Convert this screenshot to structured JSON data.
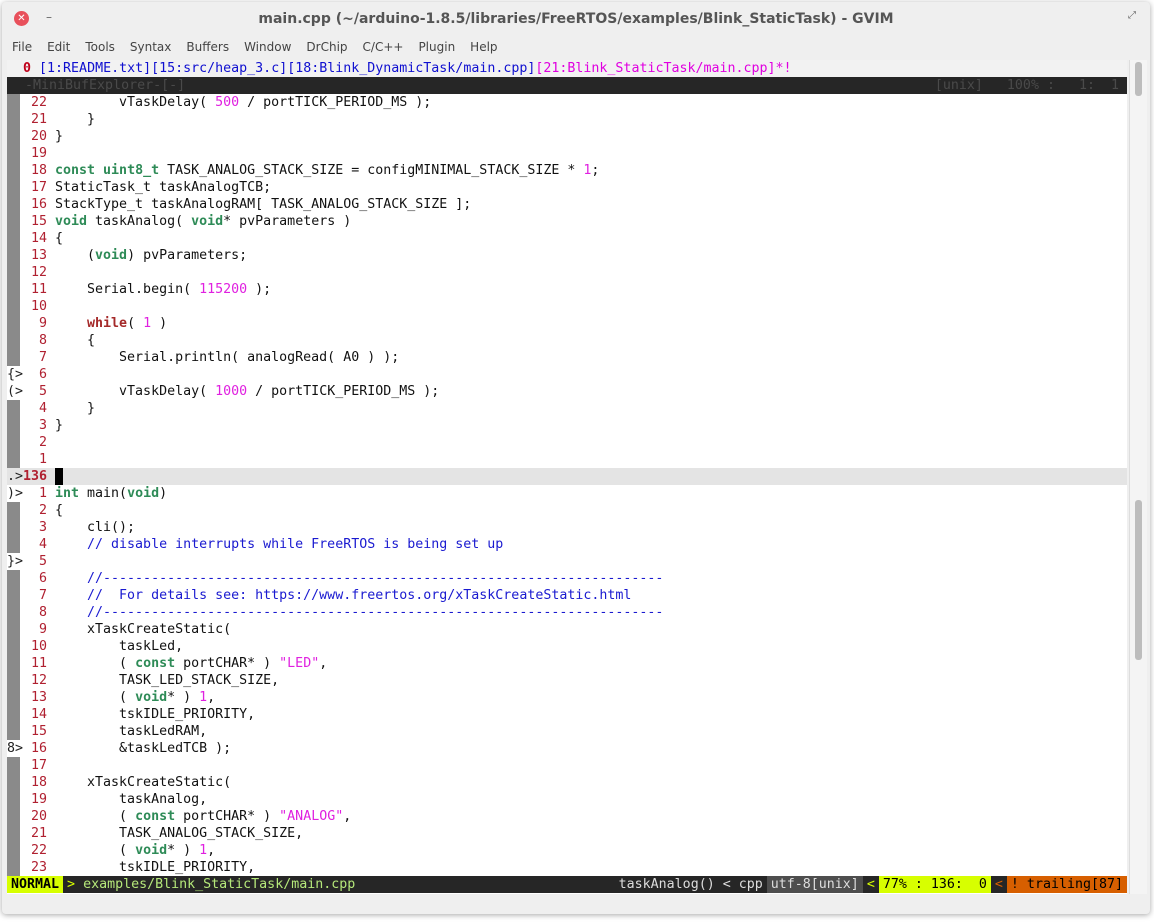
{
  "window": {
    "title": "main.cpp (~/arduino-1.8.5/libraries/FreeRTOS/examples/Blink_StaticTask) - GVIM"
  },
  "menu": [
    "File",
    "Edit",
    "Tools",
    "Syntax",
    "Buffers",
    "Window",
    "DrChip",
    "C/C++",
    "Plugin",
    "Help"
  ],
  "tabline": {
    "num": "0",
    "buffers": "[1:README.txt][15:src/heap_3.c][18:Blink_DynamicTask/main.cpp]",
    "active": "[21:Blink_StaticTask/main.cpp]*!"
  },
  "minibuf": {
    "left": "-MiniBufExplorer-[-]",
    "right": "[unix]   100% :   1:  1"
  },
  "lines": [
    {
      "n": "22",
      "t": [
        [
          "",
          "        vTaskDelay( "
        ],
        [
          "num",
          "500"
        ],
        [
          "",
          " / portTICK_PERIOD_MS );"
        ]
      ]
    },
    {
      "n": "21",
      "t": [
        [
          "",
          "    }"
        ]
      ]
    },
    {
      "n": "20",
      "t": [
        [
          "",
          "}"
        ]
      ]
    },
    {
      "n": "19",
      "t": []
    },
    {
      "n": "18",
      "t": [
        [
          "type",
          "const"
        ],
        [
          "",
          " "
        ],
        [
          "type",
          "uint8_t"
        ],
        [
          "",
          " TASK_ANALOG_STACK_SIZE = configMINIMAL_STACK_SIZE * "
        ],
        [
          "num",
          "1"
        ],
        [
          "",
          ";"
        ]
      ]
    },
    {
      "n": "17",
      "t": [
        [
          "",
          "StaticTask_t taskAnalogTCB;"
        ]
      ]
    },
    {
      "n": "16",
      "t": [
        [
          "",
          "StackType_t taskAnalogRAM[ TASK_ANALOG_STACK_SIZE ];"
        ]
      ]
    },
    {
      "n": "15",
      "t": [
        [
          "type",
          "void"
        ],
        [
          "",
          " taskAnalog( "
        ],
        [
          "type",
          "void"
        ],
        [
          "",
          "* pvParameters )"
        ]
      ]
    },
    {
      "n": "14",
      "t": [
        [
          "",
          "{"
        ]
      ]
    },
    {
      "n": "13",
      "t": [
        [
          "",
          "    ("
        ],
        [
          "type",
          "void"
        ],
        [
          "",
          ") pvParameters;"
        ]
      ]
    },
    {
      "n": "12",
      "t": []
    },
    {
      "n": "11",
      "t": [
        [
          "",
          "    Serial.begin( "
        ],
        [
          "num",
          "115200"
        ],
        [
          "",
          " );"
        ]
      ]
    },
    {
      "n": "10",
      "t": []
    },
    {
      "n": "9",
      "t": [
        [
          "",
          "    "
        ],
        [
          "kw",
          "while"
        ],
        [
          "",
          "( "
        ],
        [
          "num",
          "1"
        ],
        [
          "",
          " )"
        ]
      ]
    },
    {
      "n": "8",
      "t": [
        [
          "",
          "    {"
        ]
      ]
    },
    {
      "n": "7",
      "t": [
        [
          "",
          "        Serial.println( analogRead( A0 ) );"
        ]
      ]
    },
    {
      "n": "6",
      "s": "{>",
      "t": []
    },
    {
      "n": "5",
      "s": "(>",
      "t": [
        [
          "",
          "        vTaskDelay( "
        ],
        [
          "num",
          "1000"
        ],
        [
          "",
          " / portTICK_PERIOD_MS );"
        ]
      ]
    },
    {
      "n": "4",
      "t": [
        [
          "",
          "    }"
        ]
      ]
    },
    {
      "n": "3",
      "t": [
        [
          "",
          "}"
        ]
      ]
    },
    {
      "n": "2",
      "t": []
    },
    {
      "n": "1",
      "t": []
    },
    {
      "n": "136",
      "s": ".>",
      "cur": true,
      "t": []
    },
    {
      "n": "1",
      "s": ")>",
      "t": [
        [
          "type",
          "int"
        ],
        [
          "",
          " main("
        ],
        [
          "type",
          "void"
        ],
        [
          "",
          ")"
        ]
      ]
    },
    {
      "n": "2",
      "t": [
        [
          "",
          "{"
        ]
      ]
    },
    {
      "n": "3",
      "t": [
        [
          "",
          "    cli();"
        ]
      ]
    },
    {
      "n": "4",
      "t": [
        [
          "com",
          "    // disable interrupts while FreeRTOS is being set up"
        ]
      ]
    },
    {
      "n": "5",
      "s": "}>",
      "t": []
    },
    {
      "n": "6",
      "t": [
        [
          "com",
          "    //----------------------------------------------------------------------"
        ]
      ]
    },
    {
      "n": "7",
      "t": [
        [
          "com",
          "    //  For details see: https://www.freertos.org/xTaskCreateStatic.html"
        ]
      ]
    },
    {
      "n": "8",
      "t": [
        [
          "com",
          "    //----------------------------------------------------------------------"
        ]
      ]
    },
    {
      "n": "9",
      "t": [
        [
          "",
          "    xTaskCreateStatic("
        ]
      ]
    },
    {
      "n": "10",
      "t": [
        [
          "",
          "        taskLed,"
        ]
      ]
    },
    {
      "n": "11",
      "t": [
        [
          "",
          "        ( "
        ],
        [
          "type",
          "const"
        ],
        [
          "",
          " portCHAR* ) "
        ],
        [
          "str",
          "\"LED\""
        ],
        [
          "",
          ","
        ]
      ]
    },
    {
      "n": "12",
      "t": [
        [
          "",
          "        TASK_LED_STACK_SIZE,"
        ]
      ]
    },
    {
      "n": "13",
      "t": [
        [
          "",
          "        ( "
        ],
        [
          "type",
          "void"
        ],
        [
          "",
          "* ) "
        ],
        [
          "num",
          "1"
        ],
        [
          "",
          ","
        ]
      ]
    },
    {
      "n": "14",
      "t": [
        [
          "",
          "        tskIDLE_PRIORITY,"
        ]
      ]
    },
    {
      "n": "15",
      "t": [
        [
          "",
          "        taskLedRAM,"
        ]
      ]
    },
    {
      "n": "16",
      "s": "8>",
      "t": [
        [
          "",
          "        &taskLedTCB );"
        ]
      ]
    },
    {
      "n": "17",
      "t": []
    },
    {
      "n": "18",
      "t": [
        [
          "",
          "    xTaskCreateStatic("
        ]
      ]
    },
    {
      "n": "19",
      "t": [
        [
          "",
          "        taskAnalog,"
        ]
      ]
    },
    {
      "n": "20",
      "t": [
        [
          "",
          "        ( "
        ],
        [
          "type",
          "const"
        ],
        [
          "",
          " portCHAR* ) "
        ],
        [
          "str",
          "\"ANALOG\""
        ],
        [
          "",
          ","
        ]
      ]
    },
    {
      "n": "21",
      "t": [
        [
          "",
          "        TASK_ANALOG_STACK_SIZE,"
        ]
      ]
    },
    {
      "n": "22",
      "t": [
        [
          "",
          "        ( "
        ],
        [
          "type",
          "void"
        ],
        [
          "",
          "* ) "
        ],
        [
          "num",
          "1"
        ],
        [
          "",
          ","
        ]
      ]
    },
    {
      "n": "23",
      "t": [
        [
          "",
          "        tskIDLE_PRIORITY,"
        ]
      ]
    }
  ],
  "status": {
    "mode": "NORMAL",
    "sep1": ">",
    "file": "examples/Blink_StaticTask/main.cpp",
    "func": "taskAnalog() < cpp",
    "enc": "utf-8[unix]",
    "sep2": "<",
    "pos": "77% : 136:  0",
    "sep3": "<",
    "warn": "! trailing[87]"
  }
}
